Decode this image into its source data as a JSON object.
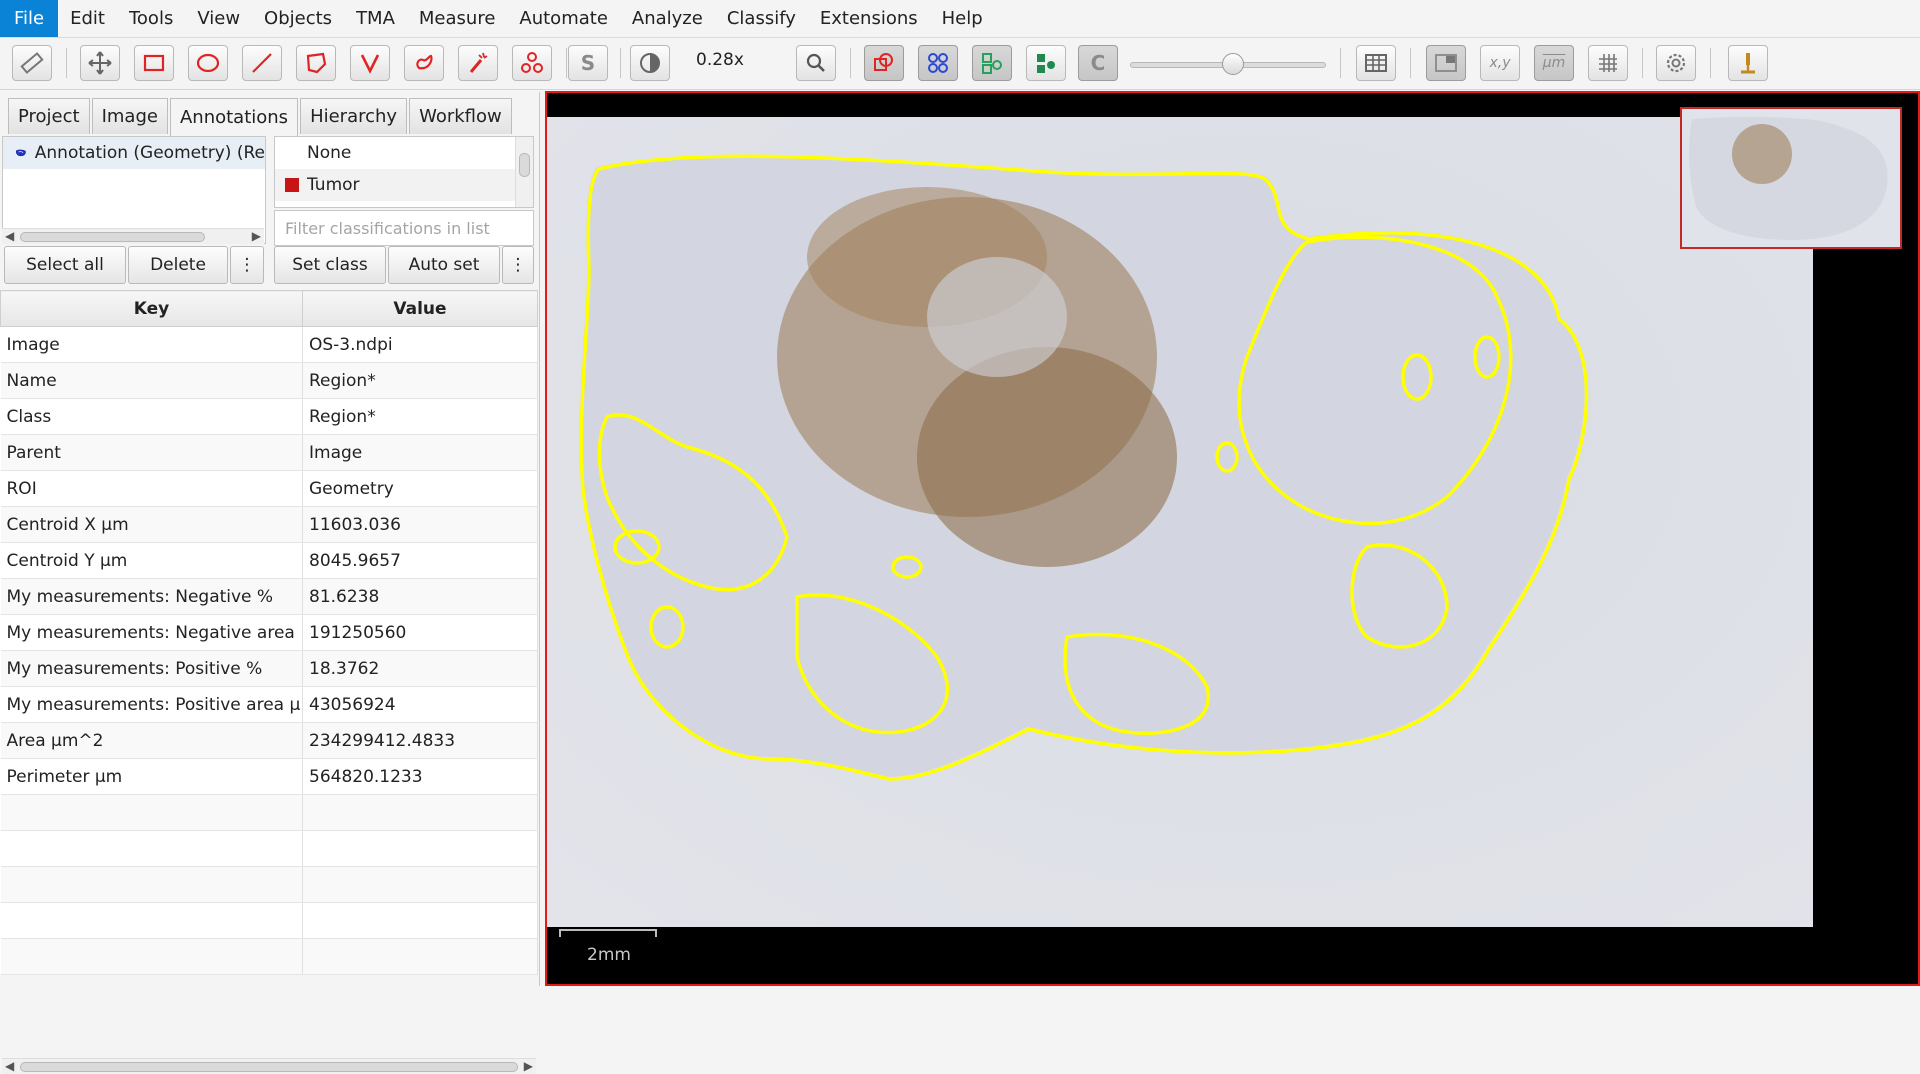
{
  "menu": {
    "items": [
      "File",
      "Edit",
      "Tools",
      "View",
      "Objects",
      "TMA",
      "Measure",
      "Automate",
      "Analyze",
      "Classify",
      "Extensions",
      "Help"
    ]
  },
  "toolbar": {
    "zoom": "0.28x",
    "brush_letter": "S",
    "c_letter": "C",
    "xy_label": "x,y",
    "um_label": "µm"
  },
  "tabs": [
    "Project",
    "Image",
    "Annotations",
    "Hierarchy",
    "Workflow"
  ],
  "annotations": {
    "items": [
      "Annotation (Geometry) (Re"
    ]
  },
  "classes": {
    "items": [
      {
        "name": "None",
        "color": ""
      },
      {
        "name": "Tumor",
        "color": "#c81414"
      }
    ],
    "filter_placeholder": "Filter classifications in list"
  },
  "buttons": {
    "select_all": "Select all",
    "delete": "Delete",
    "more": "⋮",
    "set_class": "Set class",
    "auto_set": "Auto set"
  },
  "table": {
    "headers": [
      "Key",
      "Value"
    ],
    "rows": [
      [
        "Image",
        "OS-3.ndpi"
      ],
      [
        "Name",
        "Region*"
      ],
      [
        "Class",
        "Region*"
      ],
      [
        "Parent",
        "Image"
      ],
      [
        "ROI",
        "Geometry"
      ],
      [
        "Centroid X µm",
        "11603.036"
      ],
      [
        "Centroid Y µm",
        "8045.9657"
      ],
      [
        "My measurements: Negative %",
        "81.6238"
      ],
      [
        "My measurements: Negative area ...",
        "191250560"
      ],
      [
        "My measurements: Positive %",
        "18.3762"
      ],
      [
        "My measurements: Positive area µ...",
        "43056924"
      ],
      [
        "Area µm^2",
        "234299412.4833"
      ],
      [
        "Perimeter µm",
        "564820.1233"
      ]
    ]
  },
  "viewer": {
    "scale_label": "2mm"
  },
  "colors": {
    "accent": "#0a83d6",
    "annotation": "#ffff00",
    "selection_border": "#e21a1a"
  }
}
